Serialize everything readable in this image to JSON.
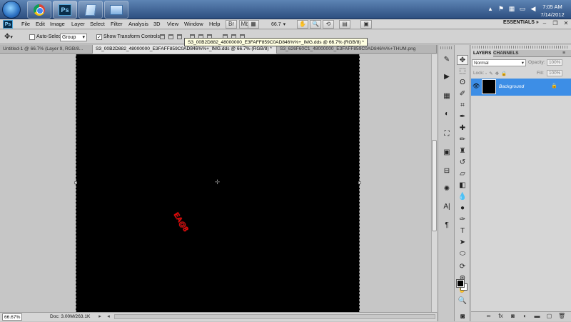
{
  "taskbar": {
    "apps": [
      {
        "name": "Google Chrome",
        "icon": "chrome-icon"
      },
      {
        "name": "Adobe Photoshop",
        "icon": "photoshop-icon",
        "label": "Ps"
      },
      {
        "name": "Notepad",
        "icon": "notepad-icon"
      },
      {
        "name": "Control Panel",
        "icon": "control-panel-icon"
      }
    ],
    "clock_time": "7:05 AM",
    "clock_date": "7/14/2012"
  },
  "menubar": {
    "logo": "Ps",
    "menus": [
      "File",
      "Edit",
      "Image",
      "Layer",
      "Select",
      "Filter",
      "Analysis",
      "3D",
      "View",
      "Window",
      "Help"
    ],
    "zoom_value": "66.7",
    "workspace": "ESSENTIALS"
  },
  "options": {
    "auto_select_label": "Auto-Select:",
    "auto_select_checked": false,
    "auto_select_value": "Group",
    "show_transform_label": "Show Transform Controls",
    "show_transform_checked": true
  },
  "tabs": [
    {
      "label": "Untitled-1 @ 66.7% (Layer 9, RGB/8...",
      "active": false
    },
    {
      "label": "S3_00B2D882_48000000_E3FAFF859C0AD846%%+_IMG.dds @ 66.7% (RGB/8) *",
      "active": true
    },
    {
      "label": "S3_626F60C1_48000000_E3FAFF859C0AD846%%+THUM.png",
      "active": false
    }
  ],
  "tooltip": "S3_00B2D882_48000000_E3FAFF859C0AD846%%+_IMG.dds @ 66.7% (RGB/8) *",
  "canvas": {
    "text": "EA@8",
    "text_color": "#e00000",
    "background": "#000000"
  },
  "status": {
    "zoom": "66.67%",
    "doc": "Doc: 3.00M/263.1K"
  },
  "layers_panel": {
    "tabs": [
      "LAYERS",
      "CHANNELS"
    ],
    "blend_mode": "Normal",
    "opacity_label": "Opacity:",
    "opacity_value": "100%",
    "lock_label": "Lock:",
    "fill_label": "Fill:",
    "fill_value": "100%",
    "layers": [
      {
        "name": "Background",
        "visible": true,
        "locked": true,
        "selected": true
      }
    ]
  },
  "colors": {
    "accent_selection": "#3d8ee6",
    "taskbar": "#3b5f92"
  }
}
